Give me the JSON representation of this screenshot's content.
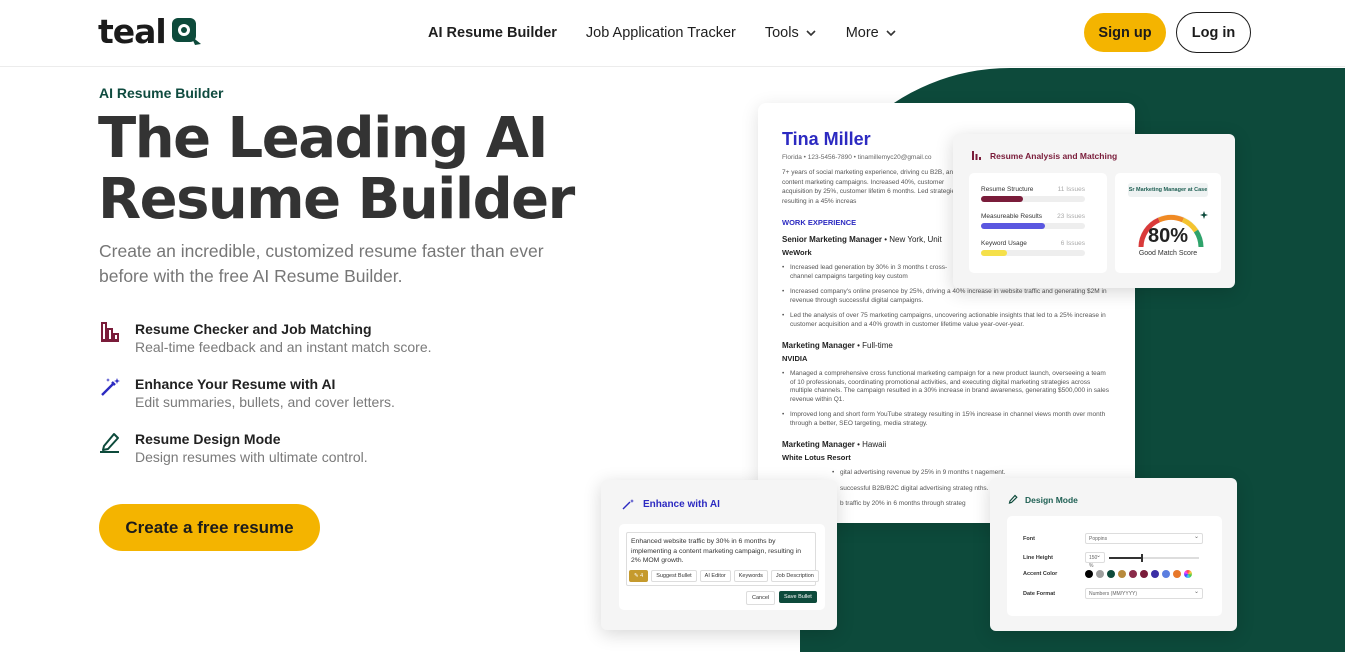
{
  "brand": {
    "logo_text": "teal"
  },
  "nav": {
    "items": [
      {
        "label": "AI Resume Builder",
        "active": true,
        "dropdown": false
      },
      {
        "label": "Job Application Tracker",
        "active": false,
        "dropdown": false
      },
      {
        "label": "Tools",
        "active": false,
        "dropdown": true
      },
      {
        "label": "More",
        "active": false,
        "dropdown": true
      }
    ],
    "signup_label": "Sign up",
    "login_label": "Log in"
  },
  "hero": {
    "eyebrow": "AI Resume Builder",
    "title_line1": "The Leading AI",
    "title_line2": "Resume Builder",
    "subtitle": "Create an incredible, customized resume faster than ever before with the free AI Resume Builder.",
    "features": [
      {
        "icon": "bar-chart-icon",
        "title": "Resume Checker and Job Matching",
        "desc": "Real-time feedback and an instant match score."
      },
      {
        "icon": "magic-wand-icon",
        "title": "Enhance Your Resume with AI",
        "desc": "Edit summaries, bullets, and cover letters."
      },
      {
        "icon": "pencil-icon",
        "title": "Resume Design Mode",
        "desc": "Design resumes with ultimate control."
      }
    ],
    "cta_label": "Create a free resume"
  },
  "resume": {
    "name": "Tina Miller",
    "contact": "Florida • 123-5456-7890 • tinamillemyc20@gmail.co",
    "summary": "7+ years of social marketing experience, driving cu B2B, and content marketing campaigns. Increased 40%, customer acquisition by 25%, customer lifetim 6 months. Led strategies, resulting in a 45% increas",
    "section_title": "WORK EXPERIENCE",
    "jobs": [
      {
        "role": "Senior Marketing Manager",
        "meta": " • New York, Unit",
        "company": "WeWork",
        "bullets": [
          "Increased lead generation by 30% in 3 months t cross-channel campaigns targeting key custom",
          "Increased company's online presence by 25%, driving a 40% increase in website traffic and generating $2M in revenue through successful digital campaigns.",
          "Led the analysis of over 75 marketing campaigns, uncovering actionable insights that led to a 25% increase in customer acquisition and a 40% growth in customer lifetime value year-over-year."
        ]
      },
      {
        "role": "Marketing Manager",
        "meta": " • Full-time",
        "company": "NVIDIA",
        "bullets": [
          "Managed a comprehensive cross functional marketing campaign for a new product launch, overseeing a team of 10 professionals, coordinating promotional activities, and executing digital marketing strategies across multiple channels. The campaign resulted in a 30% increase in brand awareness, generating $500,000 in sales revenue within Q1.",
          "Improved long and short form YouTube strategy resulting in 15% increase in channel views month over month through a better, SEO targeting, media strategy."
        ]
      },
      {
        "role": "Marketing Manager",
        "meta": " • Hawaii",
        "company": "White Lotus Resort",
        "bullets": [
          "gital advertising revenue by 25% in 9 months t nagement.",
          "successful B2B/B2C digital advertising strateg nths.",
          "b traffic by 20% in 6 months through strateg"
        ]
      }
    ]
  },
  "analysis": {
    "title": "Resume Analysis and Matching",
    "metrics": [
      {
        "label": "Resume Structure",
        "issues": "11 Issues",
        "fraction": 0.4,
        "color": "#7a1c3a"
      },
      {
        "label": "Measureable Results",
        "issues": "23 Issues",
        "fraction": 0.62,
        "color": "#5a57e0"
      },
      {
        "label": "Keyword Usage",
        "issues": "6 Issues",
        "fraction": 0.25,
        "color": "#f5e04a"
      }
    ],
    "job_label": "Sr Marketing Manager at Case",
    "score": "80%",
    "score_fraction": 0.8,
    "score_label": "Good Match Score"
  },
  "enhance": {
    "title": "Enhance with AI",
    "text": "Enhanced website traffic by 30% in 6 months by implementing a content marketing campaign, resulting in 2% MOM growth.",
    "count": "4",
    "tags": [
      "Suggest Bullet",
      "AI Editor",
      "Keywords",
      "Job Description"
    ],
    "cancel_label": "Cancel",
    "save_label": "Save Bullet"
  },
  "design": {
    "title": "Design Mode",
    "font_label": "Font",
    "font_value": "Poppins",
    "line_height_label": "Line Height",
    "line_height_value": "150 %",
    "line_height_fraction": 0.35,
    "accent_label": "Accent Color",
    "accent_colors": [
      "#000000",
      "#9e9e9e",
      "#0d4a3b",
      "#b88a3c",
      "#8a2b4a",
      "#7a1c3a",
      "#3b2fa5",
      "#5b7ee0",
      "#e8782a",
      "#d66ad0"
    ],
    "date_format_label": "Date Format",
    "date_format_value": "Numbers (MM/YYYY)"
  }
}
